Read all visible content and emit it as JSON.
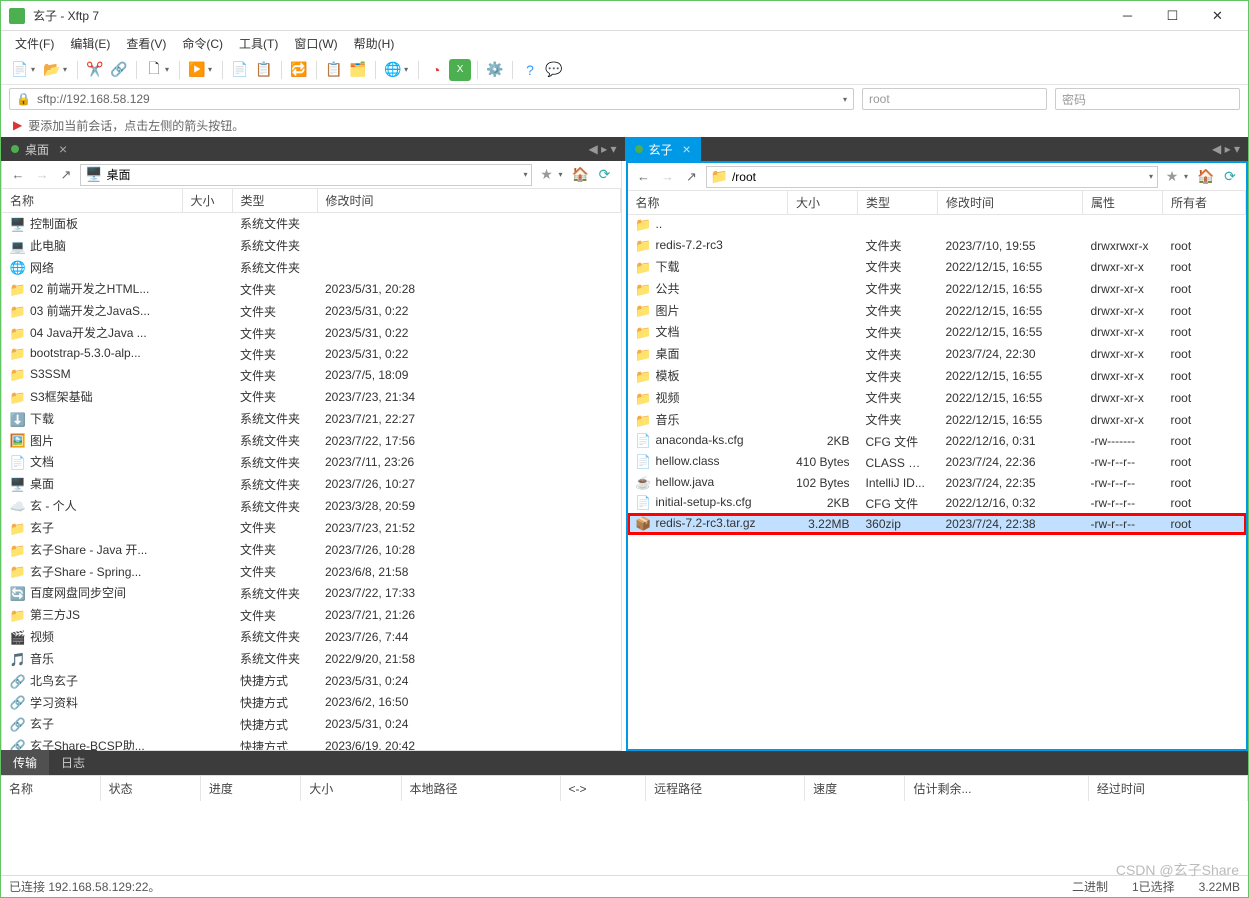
{
  "window": {
    "title": "玄子 - Xftp 7"
  },
  "menu": [
    "文件(F)",
    "编辑(E)",
    "查看(V)",
    "命令(C)",
    "工具(T)",
    "窗口(W)",
    "帮助(H)"
  ],
  "address": {
    "url": "sftp://192.168.58.129",
    "user": "root",
    "pwd_placeholder": "密码"
  },
  "hint": "要添加当前会话，点击左侧的箭头按钮。",
  "leftpane": {
    "tab": "桌面",
    "path": "桌面",
    "cols": [
      "名称",
      "大小",
      "类型",
      "修改时间"
    ],
    "rows": [
      {
        "icon": "🖥️",
        "name": "控制面板",
        "size": "",
        "type": "系统文件夹",
        "time": ""
      },
      {
        "icon": "💻",
        "name": "此电脑",
        "size": "",
        "type": "系统文件夹",
        "time": ""
      },
      {
        "icon": "🌐",
        "name": "网络",
        "size": "",
        "type": "系统文件夹",
        "time": ""
      },
      {
        "icon": "📁",
        "name": "02 前端开发之HTML...",
        "size": "",
        "type": "文件夹",
        "time": "2023/5/31, 20:28"
      },
      {
        "icon": "📁",
        "name": "03 前端开发之JavaS...",
        "size": "",
        "type": "文件夹",
        "time": "2023/5/31, 0:22"
      },
      {
        "icon": "📁",
        "name": "04 Java开发之Java ...",
        "size": "",
        "type": "文件夹",
        "time": "2023/5/31, 0:22"
      },
      {
        "icon": "📁",
        "name": "bootstrap-5.3.0-alp...",
        "size": "",
        "type": "文件夹",
        "time": "2023/5/31, 0:22"
      },
      {
        "icon": "📁",
        "name": "S3SSM",
        "size": "",
        "type": "文件夹",
        "time": "2023/7/5, 18:09"
      },
      {
        "icon": "📁",
        "name": "S3框架基础",
        "size": "",
        "type": "文件夹",
        "time": "2023/7/23, 21:34"
      },
      {
        "icon": "⬇️",
        "name": "下载",
        "size": "",
        "type": "系统文件夹",
        "time": "2023/7/21, 22:27"
      },
      {
        "icon": "🖼️",
        "name": "图片",
        "size": "",
        "type": "系统文件夹",
        "time": "2023/7/22, 17:56"
      },
      {
        "icon": "📄",
        "name": "文档",
        "size": "",
        "type": "系统文件夹",
        "time": "2023/7/11, 23:26"
      },
      {
        "icon": "🖥️",
        "name": "桌面",
        "size": "",
        "type": "系统文件夹",
        "time": "2023/7/26, 10:27"
      },
      {
        "icon": "☁️",
        "name": "玄 - 个人",
        "size": "",
        "type": "系统文件夹",
        "time": "2023/3/28, 20:59"
      },
      {
        "icon": "📁",
        "name": "玄子",
        "size": "",
        "type": "文件夹",
        "time": "2023/7/23, 21:52"
      },
      {
        "icon": "📁",
        "name": "玄子Share - Java 开...",
        "size": "",
        "type": "文件夹",
        "time": "2023/7/26, 10:28"
      },
      {
        "icon": "📁",
        "name": "玄子Share - Spring...",
        "size": "",
        "type": "文件夹",
        "time": "2023/6/8, 21:58"
      },
      {
        "icon": "🔄",
        "name": "百度网盘同步空间",
        "size": "",
        "type": "系统文件夹",
        "time": "2023/7/22, 17:33"
      },
      {
        "icon": "📁",
        "name": "第三方JS",
        "size": "",
        "type": "文件夹",
        "time": "2023/7/21, 21:26"
      },
      {
        "icon": "🎬",
        "name": "视频",
        "size": "",
        "type": "系统文件夹",
        "time": "2023/7/26, 7:44"
      },
      {
        "icon": "🎵",
        "name": "音乐",
        "size": "",
        "type": "系统文件夹",
        "time": "2022/9/20, 21:58"
      },
      {
        "icon": "🔗",
        "name": "北鸟玄子",
        "size": "",
        "type": "快捷方式",
        "time": "2023/5/31, 0:24"
      },
      {
        "icon": "🔗",
        "name": "学习资料",
        "size": "",
        "type": "快捷方式",
        "time": "2023/6/2, 16:50"
      },
      {
        "icon": "🔗",
        "name": "玄子",
        "size": "",
        "type": "快捷方式",
        "time": "2023/5/31, 0:24"
      },
      {
        "icon": "🔗",
        "name": "玄子Share-BCSP助...",
        "size": "",
        "type": "快捷方式",
        "time": "2023/6/19, 20:42"
      }
    ]
  },
  "rightpane": {
    "tab": "玄子",
    "path": "/root",
    "cols": [
      "名称",
      "大小",
      "类型",
      "修改时间",
      "属性",
      "所有者"
    ],
    "rows": [
      {
        "icon": "📁",
        "name": "..",
        "size": "",
        "type": "",
        "time": "",
        "attr": "",
        "owner": ""
      },
      {
        "icon": "📁",
        "name": "redis-7.2-rc3",
        "size": "",
        "type": "文件夹",
        "time": "2023/7/10, 19:55",
        "attr": "drwxrwxr-x",
        "owner": "root"
      },
      {
        "icon": "📁",
        "name": "下载",
        "size": "",
        "type": "文件夹",
        "time": "2022/12/15, 16:55",
        "attr": "drwxr-xr-x",
        "owner": "root"
      },
      {
        "icon": "📁",
        "name": "公共",
        "size": "",
        "type": "文件夹",
        "time": "2022/12/15, 16:55",
        "attr": "drwxr-xr-x",
        "owner": "root"
      },
      {
        "icon": "📁",
        "name": "图片",
        "size": "",
        "type": "文件夹",
        "time": "2022/12/15, 16:55",
        "attr": "drwxr-xr-x",
        "owner": "root"
      },
      {
        "icon": "📁",
        "name": "文档",
        "size": "",
        "type": "文件夹",
        "time": "2022/12/15, 16:55",
        "attr": "drwxr-xr-x",
        "owner": "root"
      },
      {
        "icon": "📁",
        "name": "桌面",
        "size": "",
        "type": "文件夹",
        "time": "2023/7/24, 22:30",
        "attr": "drwxr-xr-x",
        "owner": "root"
      },
      {
        "icon": "📁",
        "name": "模板",
        "size": "",
        "type": "文件夹",
        "time": "2022/12/15, 16:55",
        "attr": "drwxr-xr-x",
        "owner": "root"
      },
      {
        "icon": "📁",
        "name": "视频",
        "size": "",
        "type": "文件夹",
        "time": "2022/12/15, 16:55",
        "attr": "drwxr-xr-x",
        "owner": "root"
      },
      {
        "icon": "📁",
        "name": "音乐",
        "size": "",
        "type": "文件夹",
        "time": "2022/12/15, 16:55",
        "attr": "drwxr-xr-x",
        "owner": "root"
      },
      {
        "icon": "📄",
        "name": "anaconda-ks.cfg",
        "size": "2KB",
        "type": "CFG 文件",
        "time": "2022/12/16, 0:31",
        "attr": "-rw-------",
        "owner": "root"
      },
      {
        "icon": "📄",
        "name": "hellow.class",
        "size": "410 Bytes",
        "type": "CLASS 文件",
        "time": "2023/7/24, 22:36",
        "attr": "-rw-r--r--",
        "owner": "root"
      },
      {
        "icon": "☕",
        "name": "hellow.java",
        "size": "102 Bytes",
        "type": "IntelliJ ID...",
        "time": "2023/7/24, 22:35",
        "attr": "-rw-r--r--",
        "owner": "root"
      },
      {
        "icon": "📄",
        "name": "initial-setup-ks.cfg",
        "size": "2KB",
        "type": "CFG 文件",
        "time": "2022/12/16, 0:32",
        "attr": "-rw-r--r--",
        "owner": "root"
      },
      {
        "icon": "📦",
        "name": "redis-7.2-rc3.tar.gz",
        "size": "3.22MB",
        "type": "360zip",
        "time": "2023/7/24, 22:38",
        "attr": "-rw-r--r--",
        "owner": "root",
        "selected": true
      }
    ]
  },
  "logtabs": [
    "传输",
    "日志"
  ],
  "logcols": [
    "名称",
    "状态",
    "进度",
    "大小",
    "本地路径",
    "<->",
    "远程路径",
    "速度",
    "估计剩余...",
    "经过时间"
  ],
  "status": {
    "conn": "已连接 192.168.58.129:22。",
    "mode": "二进制",
    "sel": "1已选择",
    "size": "3.22MB"
  },
  "watermark": "CSDN @玄子Share"
}
